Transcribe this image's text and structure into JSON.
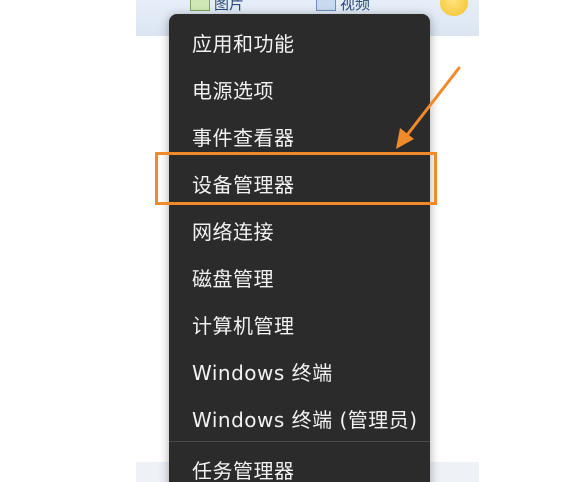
{
  "background": {
    "items": [
      {
        "label": "图片"
      },
      {
        "label": "视频"
      }
    ]
  },
  "menu": {
    "items": [
      {
        "label": "应用和功能"
      },
      {
        "label": "电源选项"
      },
      {
        "label": "事件查看器"
      },
      {
        "label": "设备管理器"
      },
      {
        "label": "网络连接"
      },
      {
        "label": "磁盘管理"
      },
      {
        "label": "计算机管理"
      },
      {
        "label": "Windows 终端"
      },
      {
        "label": "Windows 终端 (管理员)"
      },
      {
        "label": "任务管理器"
      }
    ],
    "highlighted_index": 3
  },
  "annotation": {
    "color": "#f08a2a"
  }
}
